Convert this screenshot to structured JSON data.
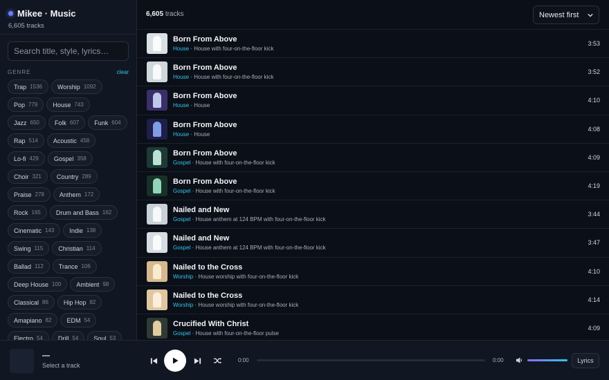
{
  "sidebar": {
    "brand_title": "Mikee · Music",
    "brand_subtitle": "6,605 tracks",
    "search_placeholder": "Search title, style, lyrics…",
    "genre_heading": "GENRE",
    "clear_label": "clear",
    "genres": [
      {
        "name": "Trap",
        "count": "1536"
      },
      {
        "name": "Worship",
        "count": "1092"
      },
      {
        "name": "Pop",
        "count": "779"
      },
      {
        "name": "House",
        "count": "743"
      },
      {
        "name": "Jazz",
        "count": "650"
      },
      {
        "name": "Folk",
        "count": "607"
      },
      {
        "name": "Funk",
        "count": "604"
      },
      {
        "name": "Rap",
        "count": "514"
      },
      {
        "name": "Acoustic",
        "count": "458"
      },
      {
        "name": "Lo-fi",
        "count": "429"
      },
      {
        "name": "Gospel",
        "count": "358"
      },
      {
        "name": "Choir",
        "count": "321"
      },
      {
        "name": "Country",
        "count": "289"
      },
      {
        "name": "Praise",
        "count": "278"
      },
      {
        "name": "Anthem",
        "count": "172"
      },
      {
        "name": "Rock",
        "count": "165"
      },
      {
        "name": "Drum and Bass",
        "count": "162"
      },
      {
        "name": "Cinematic",
        "count": "143"
      },
      {
        "name": "Indie",
        "count": "138"
      },
      {
        "name": "Swing",
        "count": "115"
      },
      {
        "name": "Christian",
        "count": "114"
      },
      {
        "name": "Ballad",
        "count": "112"
      },
      {
        "name": "Trance",
        "count": "106"
      },
      {
        "name": "Deep House",
        "count": "100"
      },
      {
        "name": "Ambient",
        "count": "98"
      },
      {
        "name": "Classical",
        "count": "86"
      },
      {
        "name": "Hip Hop",
        "count": "82"
      },
      {
        "name": "Amapiano",
        "count": "82"
      },
      {
        "name": "EDM",
        "count": "54"
      },
      {
        "name": "Electro",
        "count": "54"
      },
      {
        "name": "Drill",
        "count": "54"
      },
      {
        "name": "Soul",
        "count": "53"
      }
    ]
  },
  "header": {
    "count_value": "6,605",
    "count_suffix": "tracks",
    "sort_selected": "Newest first"
  },
  "tracks": [
    {
      "title": "Born From Above",
      "genre": "House",
      "style": "House with four-on-the-floor kick",
      "duration": "3:53",
      "art": "cathedral-light-icon",
      "art_bg": "#d9e1e4",
      "art_glow": "#ffffff"
    },
    {
      "title": "Born From Above",
      "genre": "House",
      "style": "House with four-on-the-floor kick",
      "duration": "3:52",
      "art": "cathedral-light-icon",
      "art_bg": "#cfd8da",
      "art_glow": "#ffffff"
    },
    {
      "title": "Born From Above",
      "genre": "House",
      "style": "House",
      "duration": "4:10",
      "art": "neon-arch-icon",
      "art_bg": "#3a2f6b",
      "art_glow": "#d8e4ff"
    },
    {
      "title": "Born From Above",
      "genre": "House",
      "style": "House",
      "duration": "4:08",
      "art": "neon-arch-icon",
      "art_bg": "#1f1d4a",
      "art_glow": "#8fb4ff"
    },
    {
      "title": "Born From Above",
      "genre": "Gospel",
      "style": "House with four-on-the-floor kick",
      "duration": "4:09",
      "art": "green-arch-icon",
      "art_bg": "#1d3b34",
      "art_glow": "#d6fff0"
    },
    {
      "title": "Born From Above",
      "genre": "Gospel",
      "style": "House with four-on-the-floor kick",
      "duration": "4:19",
      "art": "green-arch-icon",
      "art_bg": "#173129",
      "art_glow": "#a9f0d4"
    },
    {
      "title": "Nailed and New",
      "genre": "Gospel",
      "style": "House anthem at 124 BPM with four-on-the-floor kick",
      "duration": "3:44",
      "art": "white-light-icon",
      "art_bg": "#c9d2d8",
      "art_glow": "#ffffff"
    },
    {
      "title": "Nailed and New",
      "genre": "Gospel",
      "style": "House anthem at 124 BPM with four-on-the-floor kick",
      "duration": "3:47",
      "art": "white-light-icon",
      "art_bg": "#d6dde2",
      "art_glow": "#ffffff"
    },
    {
      "title": "Nailed to the Cross",
      "genre": "Worship",
      "style": "House worship with four-on-the-floor kick",
      "duration": "4:10",
      "art": "golden-figure-icon",
      "art_bg": "#d7b98f",
      "art_glow": "#fff3dc"
    },
    {
      "title": "Nailed to the Cross",
      "genre": "Worship",
      "style": "House worship with four-on-the-floor kick",
      "duration": "4:14",
      "art": "golden-figure-icon",
      "art_bg": "#e0c7a0",
      "art_glow": "#fff6e6"
    },
    {
      "title": "Crucified With Christ",
      "genre": "Gospel",
      "style": "House with four-on-the-floor pulse",
      "duration": "4:09",
      "art": "glowing-cross-icon",
      "art_bg": "#2f3a34",
      "art_glow": "#ffe7b5"
    }
  ],
  "player": {
    "now_playing_title": "—",
    "now_playing_subtitle": "Select a track",
    "time_elapsed": "0:00",
    "time_total": "0:00",
    "progress_fraction": 0,
    "volume_fraction": 1,
    "lyrics_label": "Lyrics"
  },
  "colors": {
    "accent": "#33c6f0",
    "brand_dot": "#6b7cff",
    "background": "#0b0f17",
    "sidebar": "#111722"
  }
}
